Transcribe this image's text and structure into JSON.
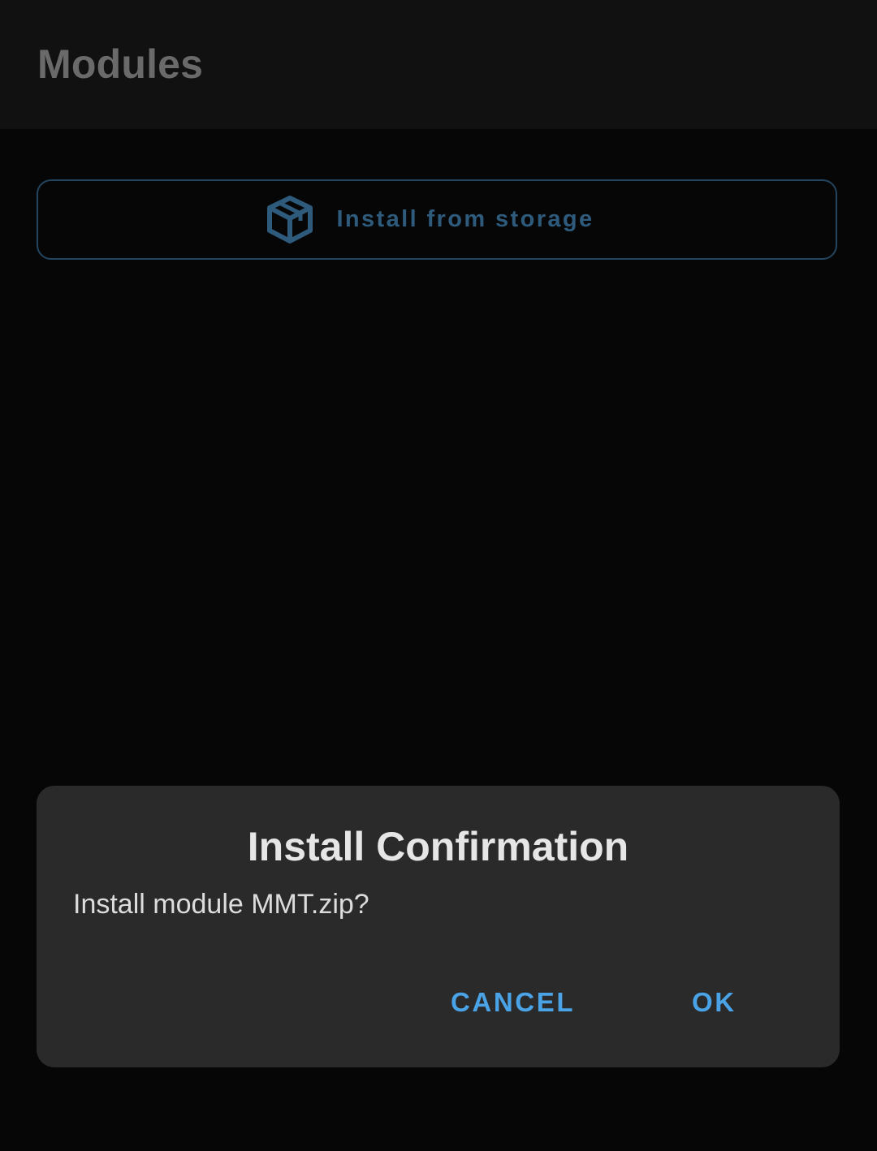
{
  "app_bar": {
    "title": "Modules"
  },
  "install_button": {
    "label": "Install from storage",
    "icon": "package-box-icon",
    "border_color": "#234560",
    "text_color": "#2e5a7c"
  },
  "dialog": {
    "title": "Install Confirmation",
    "message": "Install module MMT.zip?",
    "cancel_label": "CANCEL",
    "ok_label": "OK",
    "button_color": "#4aa3e6"
  }
}
